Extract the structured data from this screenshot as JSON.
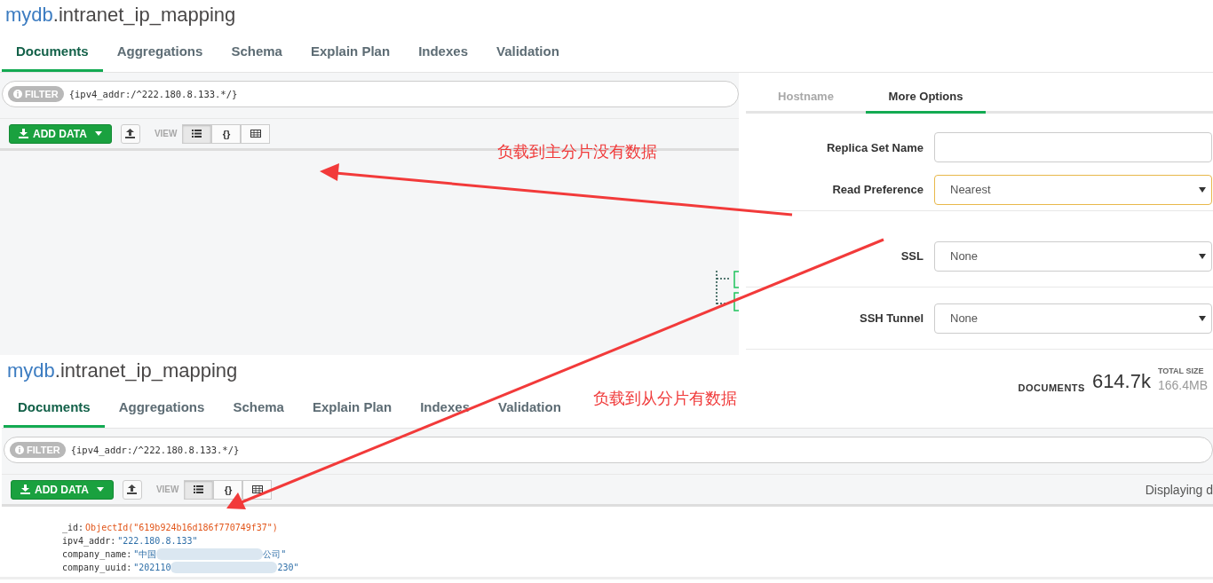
{
  "top_view": {
    "namespace": {
      "db": "mydb",
      "collection": ".intranet_ip_mapping"
    },
    "tabs": [
      {
        "label": "Documents",
        "selected": true
      },
      {
        "label": "Aggregations",
        "selected": false
      },
      {
        "label": "Schema",
        "selected": false
      },
      {
        "label": "Explain Plan",
        "selected": false
      },
      {
        "label": "Indexes",
        "selected": false
      },
      {
        "label": "Validation",
        "selected": false
      }
    ],
    "filter": {
      "label": "FILTER",
      "query": "{ipv4_addr:/^222.180.8.133.*/}"
    },
    "toolbar": {
      "add_data": "ADD DATA",
      "view_label": "VIEW",
      "view_buttons": [
        {
          "kind": "list",
          "selected": true
        },
        {
          "kind": "json",
          "label": "{}",
          "selected": false
        },
        {
          "kind": "table",
          "selected": false
        }
      ]
    }
  },
  "connection_panel": {
    "tabs": [
      {
        "label": "Hostname",
        "selected": false
      },
      {
        "label": "More Options",
        "selected": true
      }
    ],
    "fields": [
      {
        "kind": "text",
        "label": "Replica Set Name"
      },
      {
        "kind": "select",
        "label": "Read Preference",
        "value": "Nearest",
        "focused": true
      },
      {
        "kind": "select",
        "label": "SSL",
        "value": "None",
        "focused": false
      },
      {
        "kind": "select",
        "label": "SSH Tunnel",
        "value": "None",
        "focused": false
      }
    ]
  },
  "bottom_view": {
    "namespace": {
      "db": "mydb",
      "collection": ".intranet_ip_mapping"
    },
    "stats": {
      "documents_label": "DOCUMENTS",
      "documents_value": "614.7k",
      "size_label": "TOTAL SIZE",
      "size_value": "166.4MB"
    },
    "tabs": [
      {
        "label": "Documents",
        "selected": true
      },
      {
        "label": "Aggregations",
        "selected": false
      },
      {
        "label": "Schema",
        "selected": false
      },
      {
        "label": "Explain Plan",
        "selected": false
      },
      {
        "label": "Indexes",
        "selected": false
      },
      {
        "label": "Validation",
        "selected": false
      }
    ],
    "filter": {
      "label": "FILTER",
      "query": "{ipv4_addr:/^222.180.8.133.*/}"
    },
    "toolbar": {
      "add_data": "ADD DATA",
      "view_label": "VIEW",
      "view_buttons": [
        {
          "kind": "list",
          "selected": true
        },
        {
          "kind": "json",
          "label": "{}",
          "selected": false
        },
        {
          "kind": "table",
          "selected": false
        }
      ],
      "displaying": "Displaying d"
    },
    "document": [
      {
        "key": "_id:",
        "value": "ObjectId(\"619b924b16d186f770749f37\")",
        "kind": "objectid"
      },
      {
        "key": "ipv4_addr:",
        "value": "\"222.180.8.133\"",
        "kind": "string"
      },
      {
        "key": "company_name:",
        "value": "\"中国",
        "value_end": "公司\"",
        "kind": "redacted"
      },
      {
        "key": "company_uuid:",
        "value": "\"202110",
        "value_end": "230\"",
        "kind": "redacted"
      }
    ]
  },
  "annotations": [
    {
      "text": "负载到主分片没有数据",
      "kind": "primary"
    },
    {
      "text": "负载到从分片有数据",
      "kind": "secondary"
    }
  ]
}
